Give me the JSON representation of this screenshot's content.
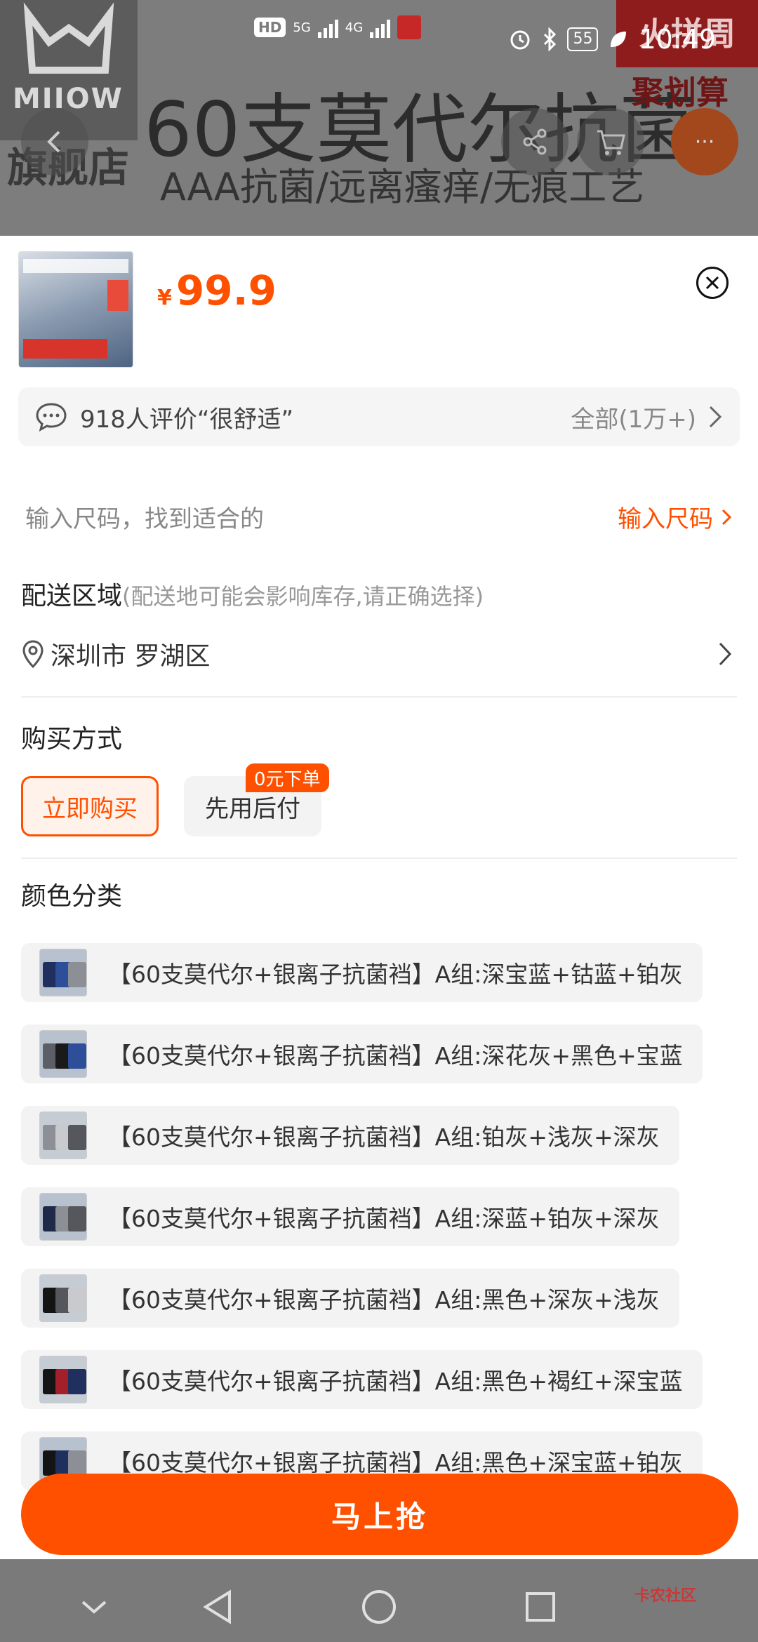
{
  "status_bar": {
    "hd": "HD",
    "net1": "5G",
    "net2": "4G",
    "battery": "55",
    "time": "10:49"
  },
  "background": {
    "brand": "MIIOW",
    "store": "旗舰店",
    "headline": "60支莫代尔抗菌",
    "subline": "AAA抗菌/远离瘙痒/无痕工艺",
    "promo": "火拼周",
    "promo2": "聚划算",
    "more": "···"
  },
  "product": {
    "currency": "¥",
    "price": "99.9"
  },
  "review": {
    "text": "918人评价“很舒适”",
    "all": "全部(1万+)"
  },
  "size": {
    "hint": "输入尺码，找到适合的",
    "link": "输入尺码"
  },
  "shipping": {
    "title": "配送区域",
    "note": "(配送地可能会影响库存,请正确选择)",
    "address": "深圳市 罗湖区"
  },
  "purchase": {
    "title": "购买方式",
    "buy_now": "立即购买",
    "pay_later": "先用后付",
    "badge": "0元下单"
  },
  "colors": {
    "title": "颜色分类",
    "items": [
      {
        "label": "【60支莫代尔+银离子抗菌裆】A组:深宝蓝+钴蓝+铂灰"
      },
      {
        "label": "【60支莫代尔+银离子抗菌裆】A组:深花灰+黑色+宝蓝"
      },
      {
        "label": "【60支莫代尔+银离子抗菌裆】A组:铂灰+浅灰+深灰"
      },
      {
        "label": "【60支莫代尔+银离子抗菌裆】A组:深蓝+铂灰+深灰"
      },
      {
        "label": "【60支莫代尔+银离子抗菌裆】A组:黑色+深灰+浅灰"
      },
      {
        "label": "【60支莫代尔+银离子抗菌裆】A组:黑色+褐红+深宝蓝"
      },
      {
        "label": "【60支莫代尔+银离子抗菌裆】A组:黑色+深宝蓝+铂灰"
      }
    ]
  },
  "cta": {
    "label": "马上抢"
  },
  "watermark": "卡农社区",
  "colors_theme": {
    "accent": "#ff5000"
  }
}
